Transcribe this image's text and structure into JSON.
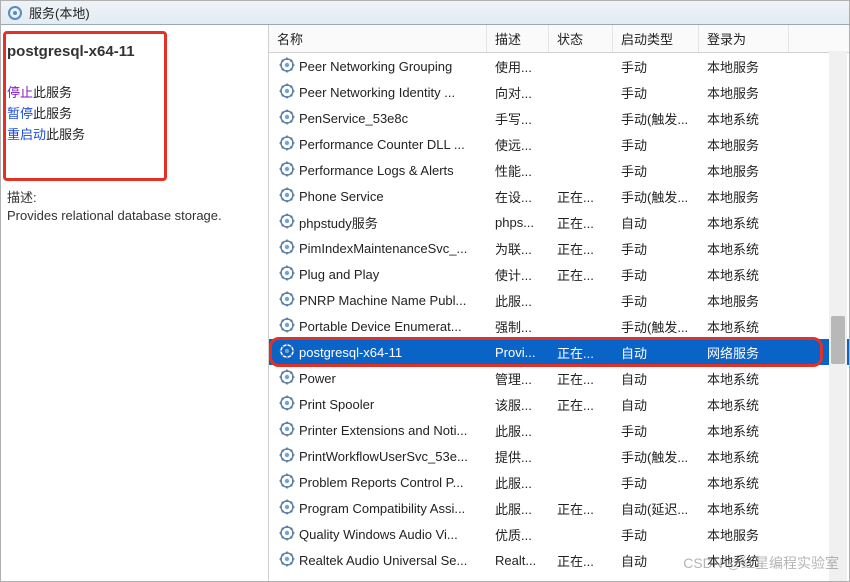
{
  "titlebar": {
    "title": "服务(本地)"
  },
  "left": {
    "selected_name": "postgresql-x64-11",
    "stop_link": "停止",
    "pause_link": "暂停",
    "restart_link": "重启动",
    "suffix": "此服务",
    "desc_label": "描述:",
    "desc_text": "Provides relational database storage."
  },
  "columns": {
    "name": "名称",
    "desc": "描述",
    "status": "状态",
    "startup": "启动类型",
    "logon": "登录为"
  },
  "rows": [
    {
      "name": "Peer Networking Grouping",
      "desc": "使用...",
      "status": "",
      "startup": "手动",
      "logon": "本地服务",
      "selected": false
    },
    {
      "name": "Peer Networking Identity ...",
      "desc": "向对...",
      "status": "",
      "startup": "手动",
      "logon": "本地服务",
      "selected": false
    },
    {
      "name": "PenService_53e8c",
      "desc": "手写...",
      "status": "",
      "startup": "手动(触发...",
      "logon": "本地系统",
      "selected": false
    },
    {
      "name": "Performance Counter DLL ...",
      "desc": "使远...",
      "status": "",
      "startup": "手动",
      "logon": "本地服务",
      "selected": false
    },
    {
      "name": "Performance Logs & Alerts",
      "desc": "性能...",
      "status": "",
      "startup": "手动",
      "logon": "本地服务",
      "selected": false
    },
    {
      "name": "Phone Service",
      "desc": "在设...",
      "status": "正在...",
      "startup": "手动(触发...",
      "logon": "本地服务",
      "selected": false
    },
    {
      "name": "phpstudy服务",
      "desc": "phps...",
      "status": "正在...",
      "startup": "自动",
      "logon": "本地系统",
      "selected": false
    },
    {
      "name": "PimIndexMaintenanceSvc_...",
      "desc": "为联...",
      "status": "正在...",
      "startup": "手动",
      "logon": "本地系统",
      "selected": false
    },
    {
      "name": "Plug and Play",
      "desc": "使计...",
      "status": "正在...",
      "startup": "手动",
      "logon": "本地系统",
      "selected": false
    },
    {
      "name": "PNRP Machine Name Publ...",
      "desc": "此服...",
      "status": "",
      "startup": "手动",
      "logon": "本地服务",
      "selected": false
    },
    {
      "name": "Portable Device Enumerat...",
      "desc": "强制...",
      "status": "",
      "startup": "手动(触发...",
      "logon": "本地系统",
      "selected": false
    },
    {
      "name": "postgresql-x64-11",
      "desc": "Provi...",
      "status": "正在...",
      "startup": "自动",
      "logon": "网络服务",
      "selected": true
    },
    {
      "name": "Power",
      "desc": "管理...",
      "status": "正在...",
      "startup": "自动",
      "logon": "本地系统",
      "selected": false
    },
    {
      "name": "Print Spooler",
      "desc": "该服...",
      "status": "正在...",
      "startup": "自动",
      "logon": "本地系统",
      "selected": false
    },
    {
      "name": "Printer Extensions and Noti...",
      "desc": "此服...",
      "status": "",
      "startup": "手动",
      "logon": "本地系统",
      "selected": false
    },
    {
      "name": "PrintWorkflowUserSvc_53e...",
      "desc": "提供...",
      "status": "",
      "startup": "手动(触发...",
      "logon": "本地系统",
      "selected": false
    },
    {
      "name": "Problem Reports Control P...",
      "desc": "此服...",
      "status": "",
      "startup": "手动",
      "logon": "本地系统",
      "selected": false
    },
    {
      "name": "Program Compatibility Assi...",
      "desc": "此服...",
      "status": "正在...",
      "startup": "自动(延迟...",
      "logon": "本地系统",
      "selected": false
    },
    {
      "name": "Quality Windows Audio Vi...",
      "desc": "优质...",
      "status": "",
      "startup": "手动",
      "logon": "本地服务",
      "selected": false
    },
    {
      "name": "Realtek Audio Universal Se...",
      "desc": "Realt...",
      "status": "正在...",
      "startup": "自动",
      "logon": "本地系统",
      "selected": false
    }
  ],
  "watermark": "CSDN @红星编程实验室"
}
